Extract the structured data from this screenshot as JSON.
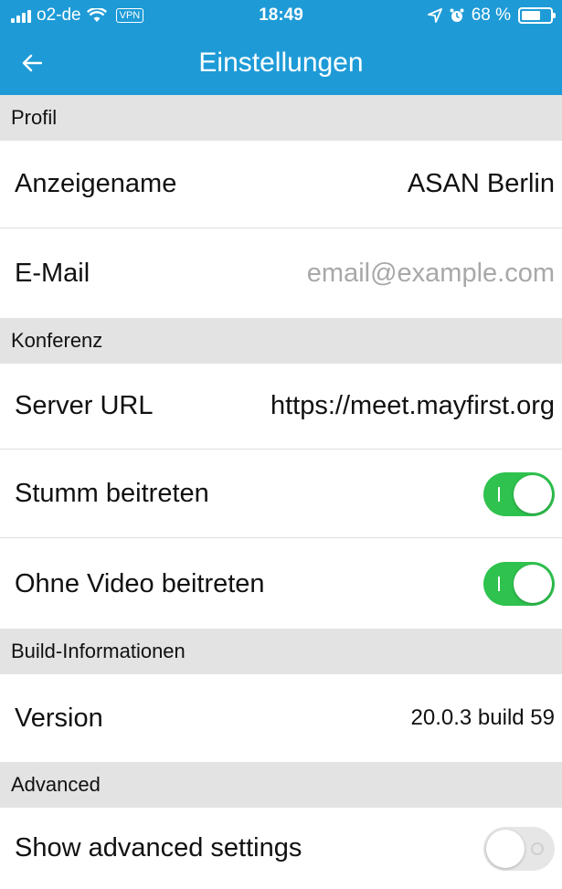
{
  "status_bar": {
    "carrier": "o2-de",
    "vpn": "VPN",
    "time": "18:49",
    "battery": "68 %",
    "battery_level": 0.68
  },
  "nav": {
    "title": "Einstellungen"
  },
  "sections": {
    "profile": {
      "header": "Profil",
      "display_name_label": "Anzeigename",
      "display_name_value": "ASAN Berlin",
      "email_label": "E-Mail",
      "email_placeholder": "email@example.com"
    },
    "conference": {
      "header": "Konferenz",
      "server_url_label": "Server URL",
      "server_url_value": "https://meet.mayfirst.org",
      "join_muted_label": "Stumm beitreten",
      "join_muted_on": true,
      "join_no_video_label": "Ohne Video beitreten",
      "join_no_video_on": true
    },
    "build": {
      "header": "Build-Informationen",
      "version_label": "Version",
      "version_value": "20.0.3 build 59"
    },
    "advanced": {
      "header": "Advanced",
      "show_advanced_label": "Show advanced settings",
      "show_advanced_on": false
    }
  },
  "colors": {
    "accent": "#1e9bd7",
    "toggle_on": "#2fc24e",
    "section_bg": "#e3e3e3"
  }
}
